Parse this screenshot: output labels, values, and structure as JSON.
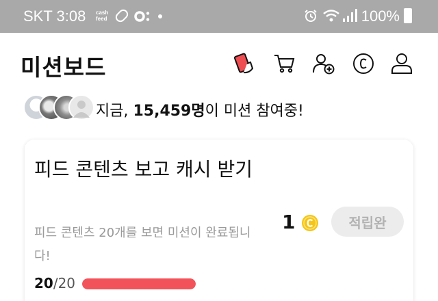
{
  "status_bar": {
    "carrier": "SKT",
    "time": "3:08",
    "cash_badge_line1": "cash",
    "cash_badge_line2": "feed",
    "battery": "100%"
  },
  "header": {
    "title": "미션보드",
    "icons": [
      "mission-card-icon",
      "cart-icon",
      "add-friend-icon",
      "coin-icon",
      "profile-icon"
    ]
  },
  "participants": {
    "prefix": "지금, ",
    "count": "15,459명",
    "suffix": "이 미션 참여중!"
  },
  "mission": {
    "title": "피드 콘텐츠 보고 캐시 받기",
    "description": "피드 콘텐츠 20개를 보면 미션이 완료됩니다!",
    "reward": "1",
    "status_button": "적립완",
    "progress_current": "20",
    "progress_total": "/20",
    "progress_fraction": 1.0,
    "colors": {
      "progress": "#f2535a",
      "coin": "#f5c518"
    }
  }
}
